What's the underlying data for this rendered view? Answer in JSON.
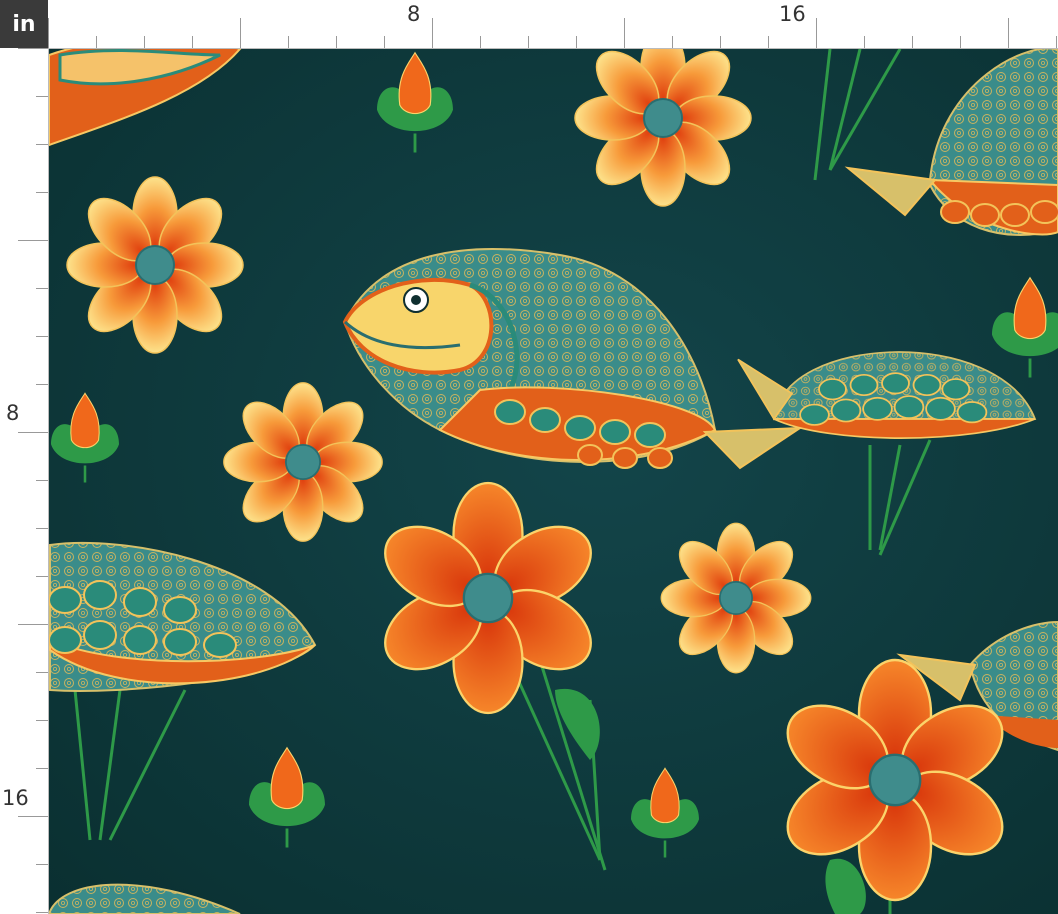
{
  "ruler": {
    "unit": "in",
    "top_labels": [
      "8",
      "16"
    ],
    "left_labels": [
      "8",
      "16"
    ]
  },
  "pattern": {
    "background": "#0f3a3a",
    "petal_orange": "#f26b1d",
    "petal_yellow": "#fde38c",
    "center_teal": "#3f8c8c",
    "leaf_green": "#2e9a48"
  }
}
